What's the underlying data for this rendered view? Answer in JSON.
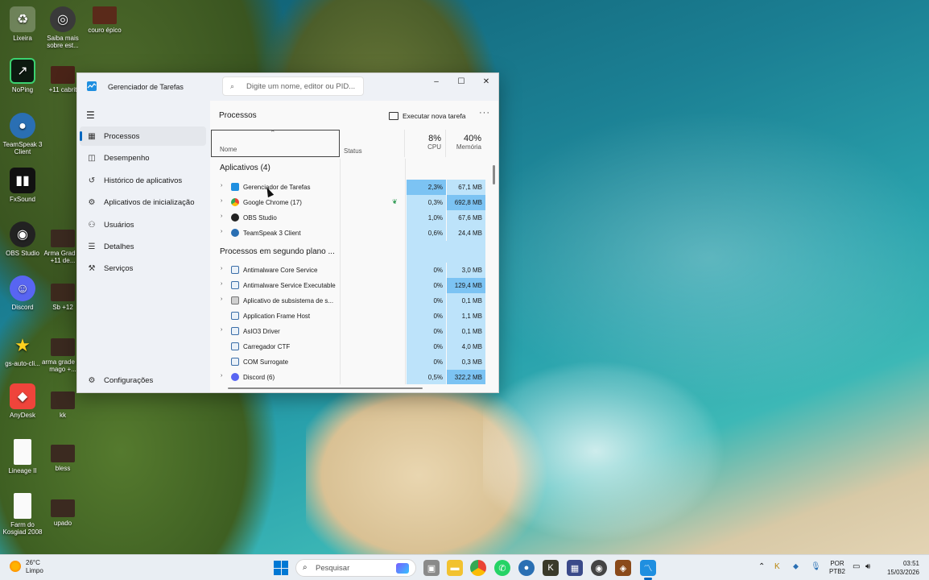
{
  "desktop": {
    "icons": [
      {
        "label": "Lixeira"
      },
      {
        "label": "Saiba mais sobre est..."
      },
      {
        "label": "couro épico"
      },
      {
        "label": "NoPing"
      },
      {
        "label": "+11 cabrit"
      },
      {
        "label": "TeamSpeak 3 Client"
      },
      {
        "label": "FxSound"
      },
      {
        "label": "OBS Studio"
      },
      {
        "label": "Arma Grad D +11 de..."
      },
      {
        "label": "Discord"
      },
      {
        "label": "Sb +12"
      },
      {
        "label": "gs-auto-cli..."
      },
      {
        "label": "arma grade de mago +..."
      },
      {
        "label": "AnyDesk"
      },
      {
        "label": "kk"
      },
      {
        "label": "Lineage II"
      },
      {
        "label": "bless"
      },
      {
        "label": "Farm do Kosgiad 2008"
      },
      {
        "label": "upado"
      }
    ]
  },
  "window": {
    "title": "Gerenciador de Tarefas",
    "search_placeholder": "Digite um nome, editor ou PID...",
    "controls": {
      "minimize": "–",
      "maximize": "☐",
      "close": "✕"
    }
  },
  "sidebar": {
    "items": [
      {
        "label": "Processos",
        "icon": "processes-icon",
        "active": true
      },
      {
        "label": "Desempenho",
        "icon": "performance-icon"
      },
      {
        "label": "Histórico de aplicativos",
        "icon": "history-icon"
      },
      {
        "label": "Aplicativos de inicialização",
        "icon": "startup-icon"
      },
      {
        "label": "Usuários",
        "icon": "users-icon"
      },
      {
        "label": "Detalhes",
        "icon": "details-icon"
      },
      {
        "label": "Serviços",
        "icon": "services-icon"
      }
    ],
    "settings_label": "Configurações"
  },
  "main": {
    "title": "Processos",
    "new_task_label": "Executar nova tarefa",
    "more_label": "···",
    "columns": {
      "name": "Nome",
      "status": "Status",
      "cpu_pct": "8%",
      "cpu": "CPU",
      "mem_pct": "40%",
      "mem": "Memória"
    },
    "groups": {
      "apps": "Aplicativos (4)",
      "background": "Processos em segundo plano ..."
    },
    "apps": [
      {
        "name": "Gerenciador de Tarefas",
        "cpu": "2,3%",
        "mem": "67,1 MB"
      },
      {
        "name": "Google Chrome (17)",
        "cpu": "0,3%",
        "mem": "692,8 MB"
      },
      {
        "name": "OBS Studio",
        "cpu": "1,0%",
        "mem": "67,6 MB"
      },
      {
        "name": "TeamSpeak 3 Client",
        "cpu": "0,6%",
        "mem": "24,4 MB"
      }
    ],
    "background": [
      {
        "name": "Antimalware Core Service",
        "cpu": "0%",
        "mem": "3,0 MB"
      },
      {
        "name": "Antimalware Service Executable",
        "cpu": "0%",
        "mem": "129,4 MB"
      },
      {
        "name": "Aplicativo de subsistema de s...",
        "cpu": "0%",
        "mem": "0,1 MB"
      },
      {
        "name": "Application Frame Host",
        "cpu": "0%",
        "mem": "1,1 MB"
      },
      {
        "name": "AsIO3 Driver",
        "cpu": "0%",
        "mem": "0,1 MB"
      },
      {
        "name": "Carregador CTF",
        "cpu": "0%",
        "mem": "4,0 MB"
      },
      {
        "name": "COM Surrogate",
        "cpu": "0%",
        "mem": "0,3 MB"
      },
      {
        "name": "Discord (6)",
        "cpu": "0,5%",
        "mem": "322,2 MB"
      }
    ]
  },
  "taskbar": {
    "weather_temp": "26°C",
    "weather_desc": "Limpo",
    "search_label": "Pesquisar",
    "lang_top": "POR",
    "lang_bottom": "PTB2",
    "time": "03:51",
    "date": "15/03/2026"
  },
  "colors": {
    "accent": "#0067c0",
    "cpu_fill": "#bde3fa",
    "cpu_fill_high": "#7cc3f3"
  }
}
